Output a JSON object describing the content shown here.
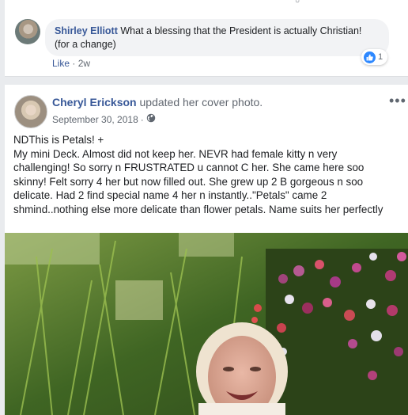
{
  "comment": {
    "author": "Shirley Elliott",
    "text_line1": "What a blessing that the President is actually Christian!",
    "text_line2": "(for a change)",
    "like_label": "Like",
    "separator": "·",
    "time": "2w",
    "reaction_count": "1"
  },
  "post": {
    "author": "Cheryl Erickson",
    "action": "updated her cover photo.",
    "date": "September 30, 2018",
    "date_separator": "·",
    "more_label": "•••",
    "text_lines": [
      "NDThis is Petals! +",
      "My mini Deck. Almost did not keep her. NEVR had female kitty n very",
      "challenging! So sorry n FRUSTRATED u cannot C her. She came here soo",
      "skinny! Felt sorry 4 her but now filled out. She grew up 2 B gorgeous n soo",
      "delicate. Had 2 find special name 4 her n instantly..\"Petals\" came 2",
      "shmind..nothing else more delicate than flower petals. Name suits her perfectly"
    ]
  },
  "icons": {
    "audience": "globe-icon",
    "reaction": "like-reaction-icon",
    "more": "more-options-icon"
  },
  "colors": {
    "link": "#385898",
    "like_badge": "#2d88ff",
    "background": "#e9ebee"
  }
}
